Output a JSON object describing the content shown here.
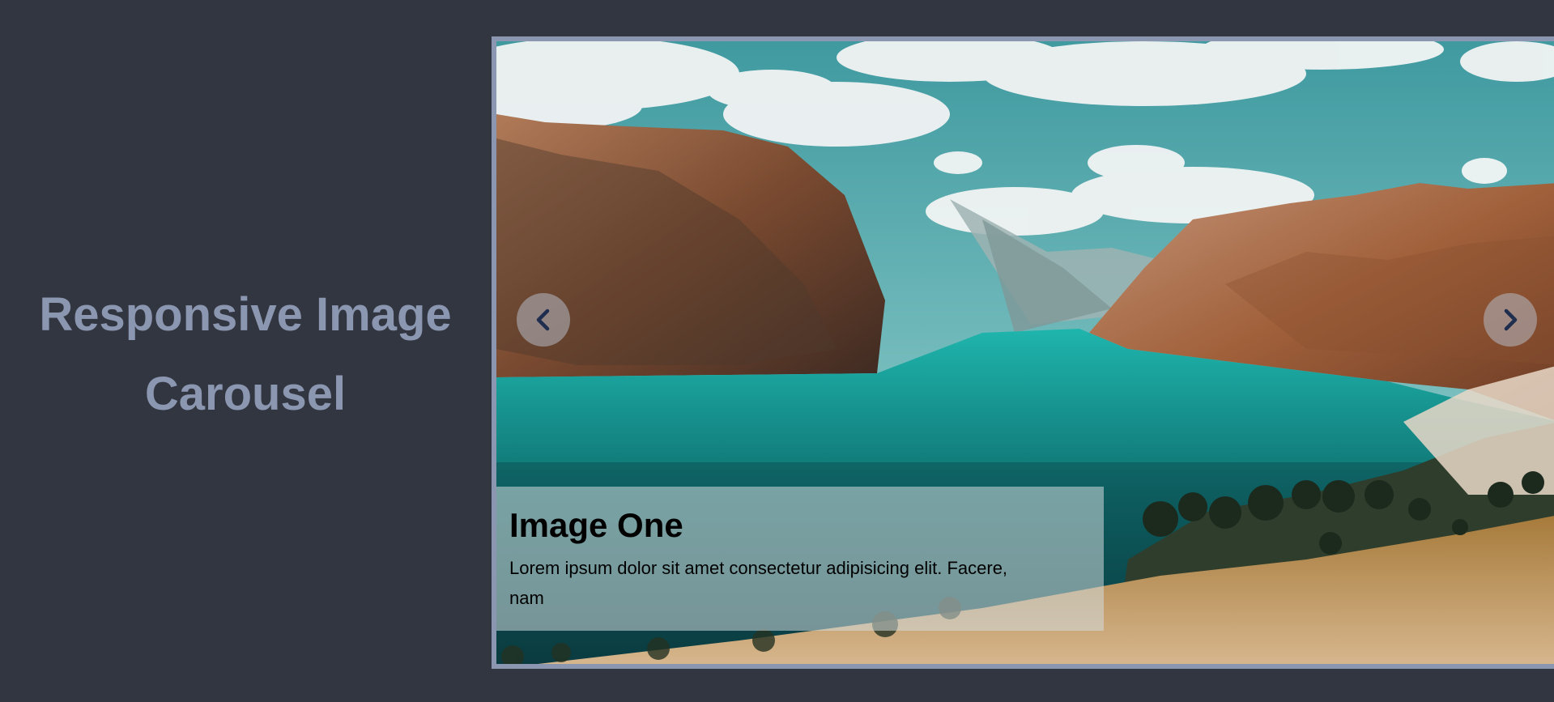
{
  "page": {
    "title_line1": "Responsive Image",
    "title_line2": "Carousel"
  },
  "carousel": {
    "slide": {
      "title": "Image One",
      "description_line1": "Lorem ipsum dolor sit amet consectetur adipisicing elit. Facere,",
      "description_line2": "nam",
      "image_icon": "fjord-landscape-photo"
    },
    "prev_icon": "chevron-left-icon",
    "next_icon": "chevron-right-icon"
  },
  "colors": {
    "background": "#323640",
    "title": "#8b96b0",
    "border": "#8b96b0",
    "caption_bg": "rgba(210,218,220,0.55)",
    "chevron": "#1f2d4f"
  }
}
